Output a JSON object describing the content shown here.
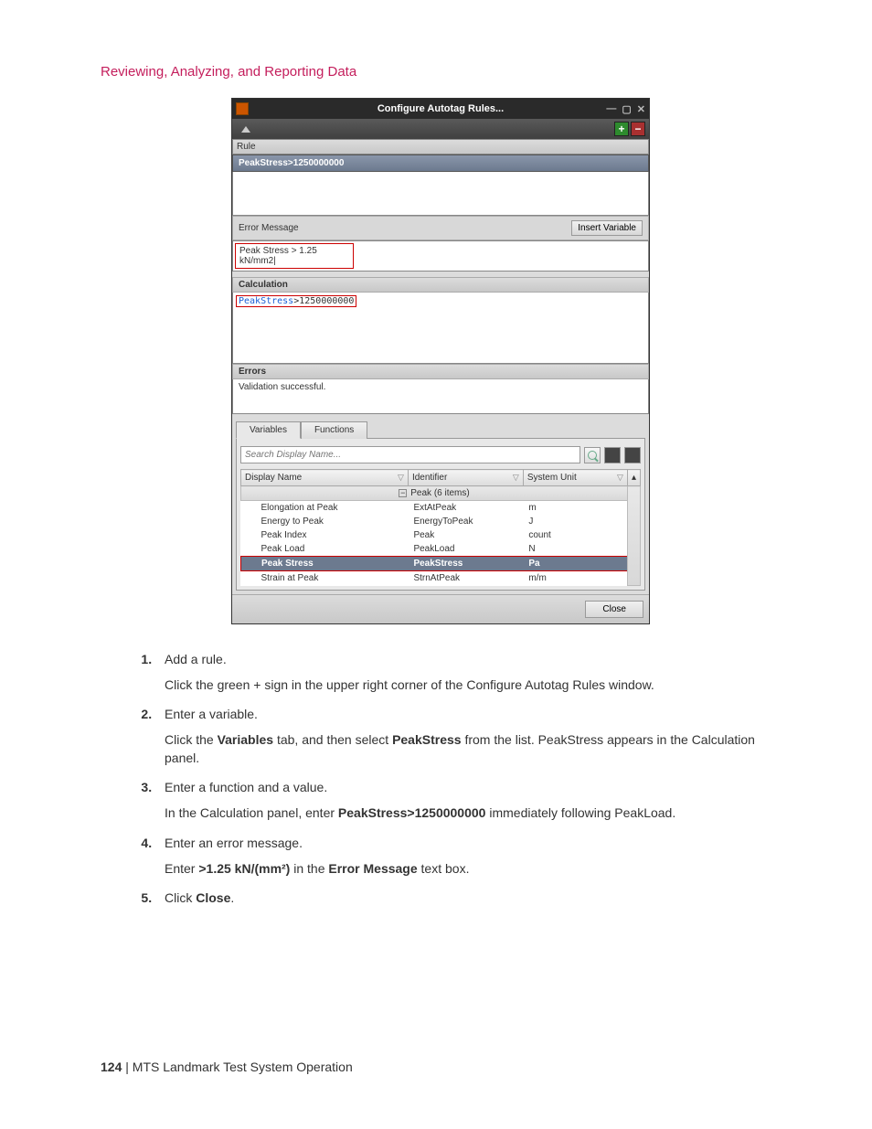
{
  "section_title": "Reviewing, Analyzing, and Reporting Data",
  "dialog": {
    "title": "Configure Autotag Rules...",
    "rule_header": "Rule",
    "rule_selected": "PeakStress>1250000000",
    "error_label": "Error Message",
    "insert_variable": "Insert Variable",
    "error_value": "Peak Stress > 1.25 kN/mm2|",
    "calculation_label": "Calculation",
    "calc_kw": "PeakStress",
    "calc_rest": ">1250000000",
    "errors_label": "Errors",
    "errors_text": "Validation successful.",
    "tab_variables": "Variables",
    "tab_functions": "Functions",
    "search_placeholder": "Search Display Name...",
    "col_display": "Display Name",
    "col_identifier": "Identifier",
    "col_unit": "System Unit",
    "group_label": "Peak (6 items)",
    "rows": [
      {
        "display": "Elongation at Peak",
        "id": "ExtAtPeak",
        "unit": "m"
      },
      {
        "display": "Energy to Peak",
        "id": "EnergyToPeak",
        "unit": "J"
      },
      {
        "display": "Peak Index",
        "id": "Peak",
        "unit": "count"
      },
      {
        "display": "Peak Load",
        "id": "PeakLoad",
        "unit": "N"
      },
      {
        "display": "Peak Stress",
        "id": "PeakStress",
        "unit": "Pa",
        "selected": true
      },
      {
        "display": "Strain at Peak",
        "id": "StrnAtPeak",
        "unit": "m/m"
      }
    ],
    "close": "Close"
  },
  "steps": [
    {
      "title": "Add a rule.",
      "body": "Click the green + sign in the upper right corner of the Configure Autotag Rules window."
    },
    {
      "title": "Enter a variable.",
      "body_html": "Click the <strong>Variables</strong> tab, and then select <strong>PeakStress</strong> from the list. PeakStress appears in the Calculation panel."
    },
    {
      "title": "Enter a function and a value.",
      "body_html": "In the Calculation panel, enter <strong>PeakStress>1250000000</strong> immediately following PeakLoad."
    },
    {
      "title": "Enter an error message.",
      "body_html": "Enter <strong>>1.25 kN/(mm²)</strong> in the <strong>Error Message</strong> text box."
    },
    {
      "title_html": "Click <strong>Close</strong>."
    }
  ],
  "footer": {
    "page": "124",
    "sep": " | ",
    "doc": "MTS Landmark Test System Operation"
  }
}
